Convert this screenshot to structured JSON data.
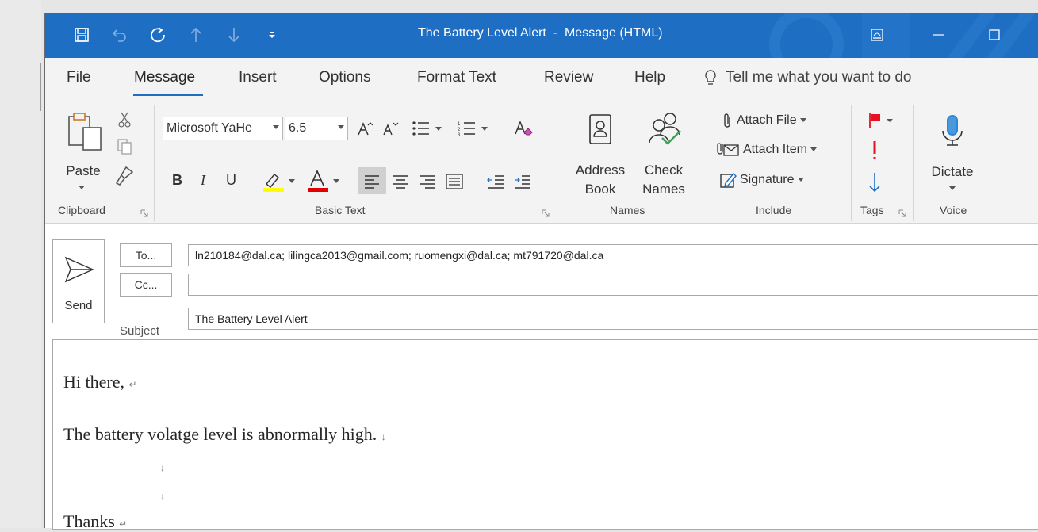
{
  "window": {
    "title": "The Battery Level Alert  -  Message (HTML)"
  },
  "tabs": [
    {
      "label": "File"
    },
    {
      "label": "Message"
    },
    {
      "label": "Insert"
    },
    {
      "label": "Options"
    },
    {
      "label": "Format Text"
    },
    {
      "label": "Review"
    },
    {
      "label": "Help"
    }
  ],
  "tell_me": "Tell me what you want to do",
  "ribbon": {
    "clipboard": {
      "paste": "Paste",
      "group": "Clipboard"
    },
    "basic_text": {
      "font": "Microsoft YaHe",
      "size": "6.5",
      "group": "Basic Text"
    },
    "names": {
      "address_book": "Address",
      "address_book_2": "Book",
      "check_names": "Check",
      "check_names_2": "Names",
      "group": "Names"
    },
    "include": {
      "attach_file": "Attach File",
      "attach_item": "Attach Item",
      "signature": "Signature",
      "group": "Include"
    },
    "tags": {
      "group": "Tags"
    },
    "voice": {
      "dictate": "Dictate",
      "group": "Voice"
    }
  },
  "header": {
    "send": "Send",
    "to_button": "To...",
    "cc_button": "Cc...",
    "subject_label": "Subject",
    "to_value": "ln210184@dal.ca; lilingca2013@gmail.com; ruomengxi@dal.ca; mt791720@dal.ca",
    "cc_value": "",
    "subject_value": "The Battery Level Alert"
  },
  "body": {
    "line1": "Hi there, ",
    "line2": "The battery volatge level is abnormally high. ",
    "line3": "Thanks ",
    "mark_enter": "↵",
    "mark_down": "↓"
  },
  "colors": {
    "accent": "#1e6ec4",
    "highlight": "#ffff00",
    "font_color": "#e00000",
    "flag_red": "#e81123"
  }
}
